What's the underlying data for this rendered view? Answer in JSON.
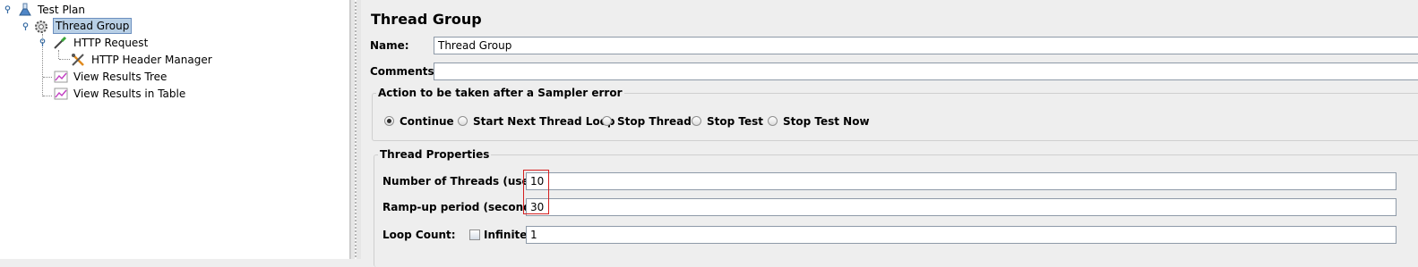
{
  "tree": {
    "items": [
      {
        "label": "Test Plan",
        "icon": "test-plan-icon"
      },
      {
        "label": "Thread Group",
        "icon": "thread-group-gear-icon",
        "selected": true
      },
      {
        "label": "HTTP Request",
        "icon": "http-request-pipette-icon"
      },
      {
        "label": "HTTP Header Manager",
        "icon": "header-manager-tools-icon"
      },
      {
        "label": "View Results Tree",
        "icon": "results-graph-icon"
      },
      {
        "label": "View Results in Table",
        "icon": "results-graph-icon"
      }
    ]
  },
  "panel": {
    "title": "Thread Group",
    "name_label": "Name:",
    "name_value": "Thread Group",
    "comments_label": "Comments:",
    "comments_value": "",
    "sampler_error": {
      "title": "Action to be taken after a Sampler error",
      "options": [
        {
          "label": "Continue",
          "selected": true
        },
        {
          "label": "Start Next Thread Loop",
          "selected": false
        },
        {
          "label": "Stop Thread",
          "selected": false
        },
        {
          "label": "Stop Test",
          "selected": false
        },
        {
          "label": "Stop Test Now",
          "selected": false
        }
      ]
    },
    "thread_properties": {
      "title": "Thread Properties",
      "threads_label": "Number of Threads (users):",
      "threads_value": "10",
      "rampup_label": "Ramp-up period (seconds):",
      "rampup_value": "30",
      "loop_label": "Loop Count:",
      "infinite_label": "Infinite",
      "infinite_checked": false,
      "loop_value": "1"
    }
  },
  "colors": {
    "selection": "#b8cfe5",
    "highlight_box": "#d42020",
    "panel_bg": "#eeeeee"
  }
}
